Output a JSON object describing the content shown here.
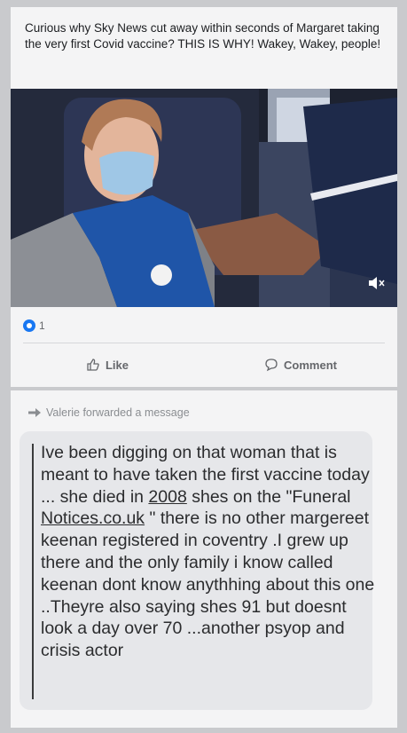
{
  "post": {
    "text": "Curious why Sky News cut away within seconds of Margaret taking the very first Covid vaccine? THIS IS WHY! Wakey, Wakey, people!",
    "reaction_count": "1",
    "like_label": "Like",
    "comment_label": "Comment"
  },
  "forwarded": {
    "label": "Valerie forwarded a message",
    "message_part1": "Ive been digging on that woman that is meant to have taken the first vaccine today ... she died in ",
    "message_year": "2008",
    "message_part2": " shes on the \"Funeral ",
    "message_link": "Notices.co.uk",
    "message_part3": " \" there is no other margereet keenan registered in coventry .I grew up there and the only family i know called keenan dont know anythhing about this one ..Theyre also saying shes 91 but doesnt look a day over 70 ...another psyop and crisis actor"
  },
  "colors": {
    "like_blue": "#1877f2",
    "card_bg": "#f4f4f5",
    "bubble_bg": "#e6e7ea"
  },
  "icons": [
    "thumbs-up-icon",
    "comment-icon",
    "speaker-muted-icon",
    "forward-arrow-icon"
  ]
}
